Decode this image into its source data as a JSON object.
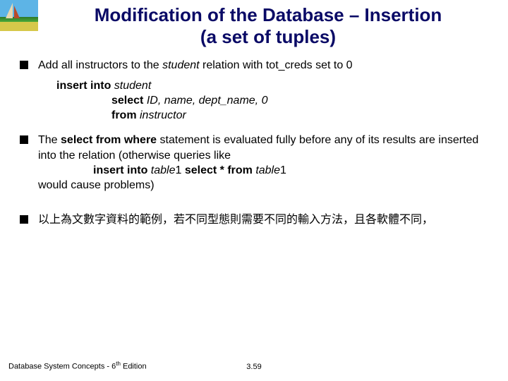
{
  "title": {
    "line1": "Modification of the Database – Insertion",
    "line2": "(a set of tuples)"
  },
  "bullets": {
    "b1_pre": "Add all instructors to the ",
    "b1_em": "student",
    "b1_post": " relation with tot_creds set to 0",
    "code": {
      "l1a": "insert into ",
      "l1b": "student",
      "l2a": "select ",
      "l2b": "ID, name, dept_name, 0",
      "l3a": "from   ",
      "l3b": "instructor"
    },
    "b2_pre": "The ",
    "b2_bold": "select from where",
    "b2_mid": " statement is evaluated fully before any of its results are inserted into the relation (otherwise queries like",
    "b2_ins_a": "insert into ",
    "b2_ins_b": "table",
    "b2_ins_c": "1 ",
    "b2_ins_d": "select * ",
    "b2_ins_e": "from ",
    "b2_ins_f": "table",
    "b2_ins_g": "1",
    "b2_tail": "would cause problems)",
    "b3": "以上為文數字資料的範例，若不同型態則需要不同的輸入方法，且各軟體不同，"
  },
  "footer": {
    "left_a": "Database System Concepts - 6",
    "left_sup": "th",
    "left_b": " Edition",
    "center": "3.59"
  }
}
